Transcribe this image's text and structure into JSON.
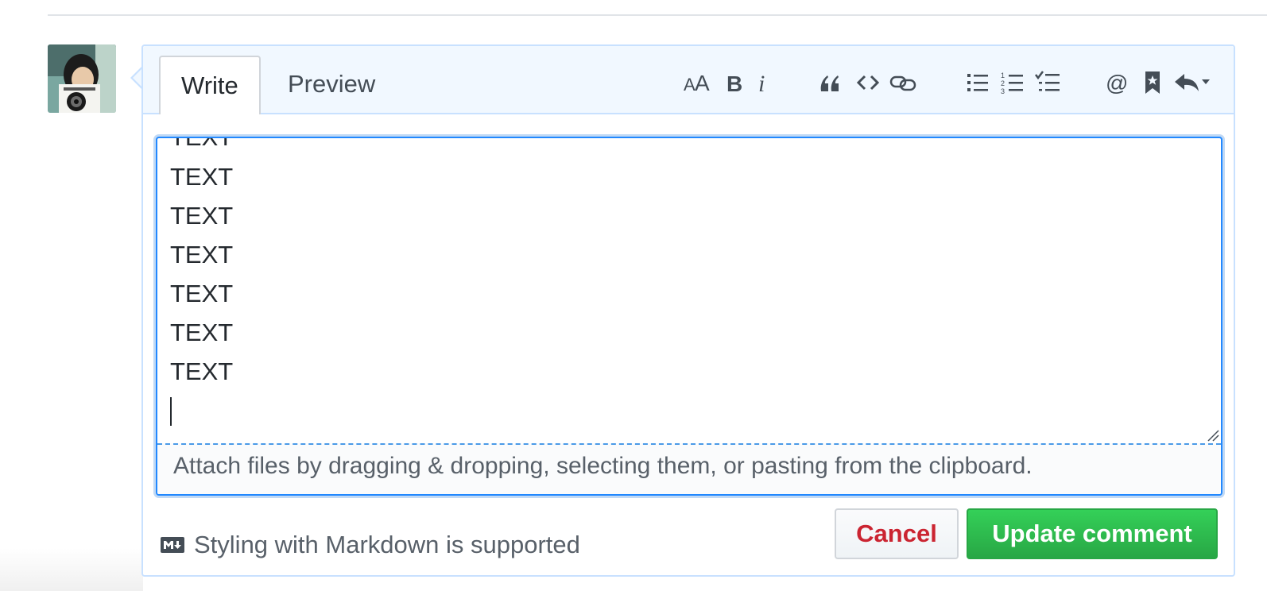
{
  "tabs": {
    "write": "Write",
    "preview": "Preview"
  },
  "toolbar": {
    "items": [
      "header-text-icon",
      "bold-icon",
      "italic-icon",
      "quote-icon",
      "code-icon",
      "link-icon",
      "bulleted-list-icon",
      "numbered-list-icon",
      "task-list-icon",
      "mention-icon",
      "reference-icon",
      "reply-icon"
    ]
  },
  "editor": {
    "lines": [
      "TEXT",
      "TEXT",
      "TEXT",
      "TEXT",
      "TEXT",
      "TEXT",
      "TEXT"
    ]
  },
  "dropzone": {
    "text": "Attach files by dragging & dropping, selecting them, or pasting from the clipboard."
  },
  "footer": {
    "markdown_note": "Styling with Markdown is supported",
    "cancel_label": "Cancel",
    "update_label": "Update comment"
  },
  "colors": {
    "accent_blue": "#2188ff",
    "cancel_red": "#cb2431",
    "update_green": "#28a745"
  }
}
